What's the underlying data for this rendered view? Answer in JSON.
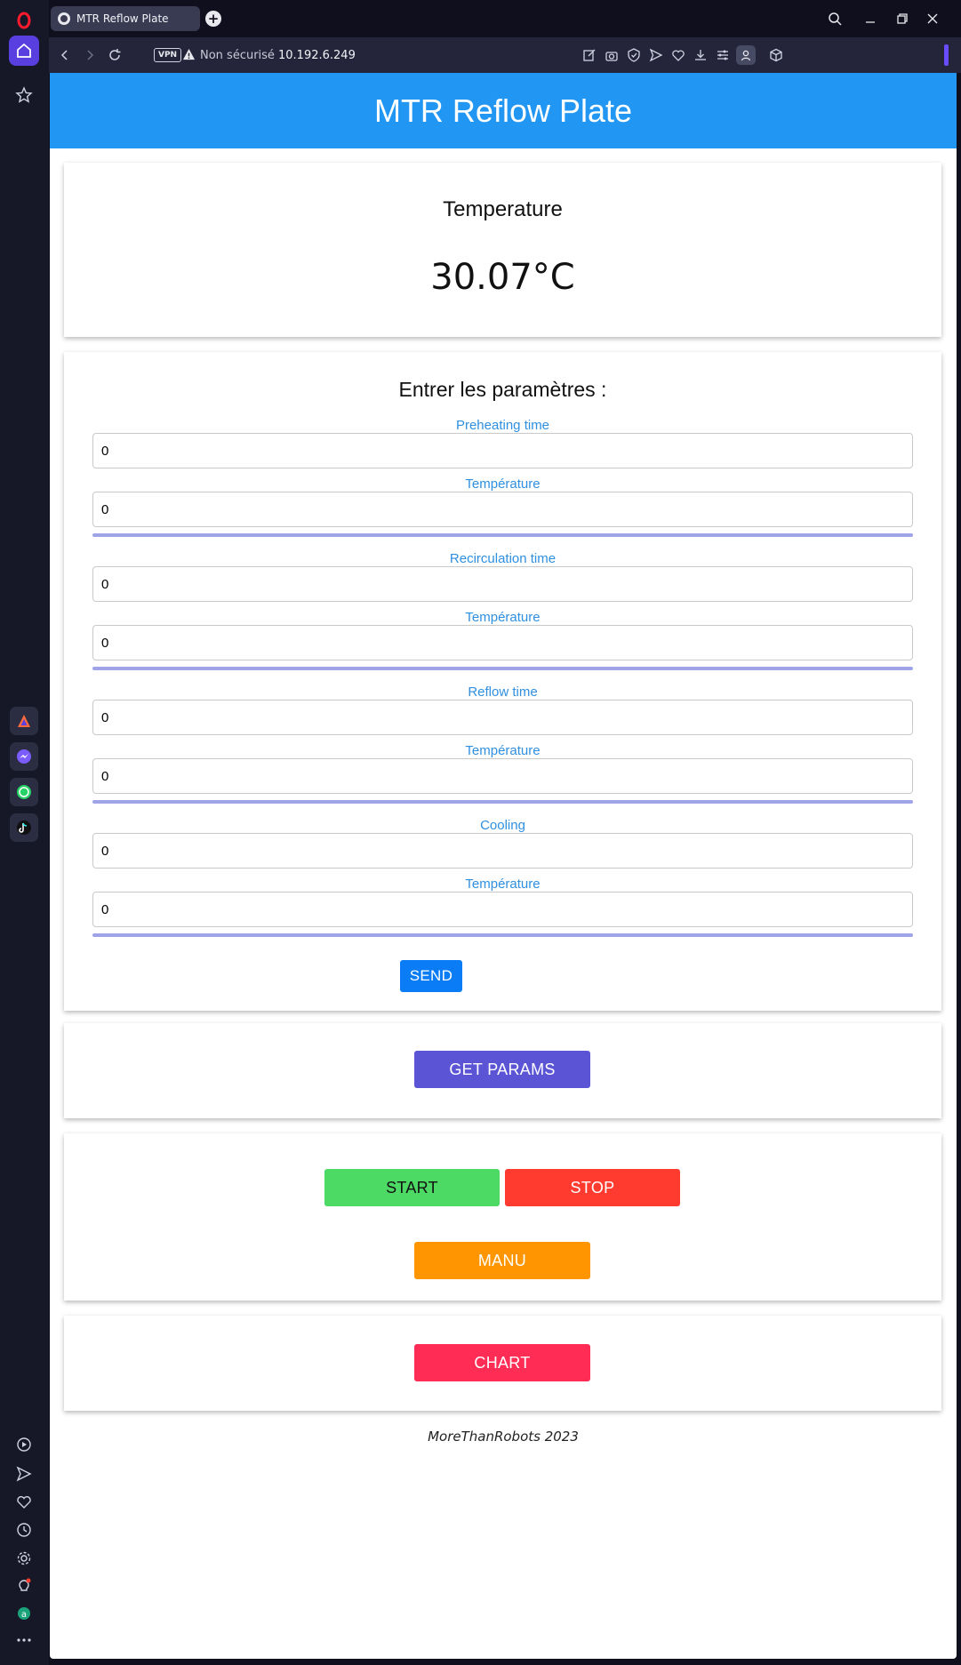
{
  "browser": {
    "tab_title": "MTR Reflow Plate",
    "new_tab_icon": "plus-icon",
    "vpn_badge": "VPN",
    "security_text": "Non sécurisé",
    "url": "10.192.6.249"
  },
  "page": {
    "header_title": "MTR Reflow Plate",
    "temperature_card": {
      "title": "Temperature",
      "value": "30.07°C"
    },
    "params_card": {
      "title": "Entrer les paramètres :",
      "groups": [
        {
          "time_label": "Preheating time",
          "time_value": "0",
          "temp_label": "Température",
          "temp_value": "0"
        },
        {
          "time_label": "Recirculation time",
          "time_value": "0",
          "temp_label": "Température",
          "temp_value": "0"
        },
        {
          "time_label": "Reflow time",
          "time_value": "0",
          "temp_label": "Température",
          "temp_value": "0"
        },
        {
          "time_label": "Cooling",
          "time_value": "0",
          "temp_label": "Température",
          "temp_value": "0"
        }
      ],
      "send_label": "SEND"
    },
    "get_params_label": "GET PARAMS",
    "start_label": "START",
    "stop_label": "STOP",
    "manu_label": "MANU",
    "chart_label": "CHART",
    "footer": "MoreThanRobots 2023"
  },
  "colors": {
    "header": "#2196f3",
    "label_blue": "#2f8fe0",
    "separator": "#9fa3e8",
    "send": "#0a7cf5",
    "get_params": "#5b55d6",
    "start": "#4cd964",
    "stop": "#ff3b30",
    "manu": "#ff9500",
    "chart": "#ff2d55"
  }
}
